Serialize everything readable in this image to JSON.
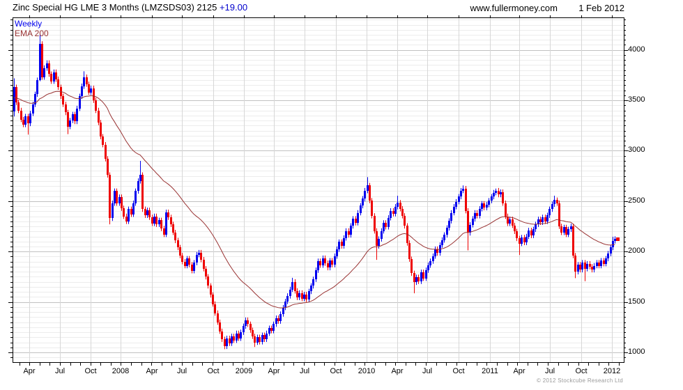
{
  "header": {
    "instrument": "Zinc Special HG LME 3 Months (LMZSDS03) 2125",
    "change": "+19.00",
    "website": "www.fullermoney.com",
    "date": "1 Feb 2012"
  },
  "legend": {
    "timeframe": "Weekly",
    "overlay": "EMA 200"
  },
  "footer": {
    "copyright": "© 2012 Stockcube Research Ltd"
  },
  "colors": {
    "up": "#0000ee",
    "down": "#ee0000",
    "ema": "#993333",
    "grid_minor": "#ececec",
    "grid_major": "#c1c1c1",
    "grid_vertical": "#d7d7d7",
    "frame": "#000000",
    "last_price_marker": "#ee0000",
    "change_text": "#0000cc",
    "copyright_text": "#9a9a9a"
  },
  "chart_data": {
    "type": "candlestick",
    "title": "Zinc Special HG LME 3 Months (LMZSDS03)",
    "timeframe": "Weekly",
    "overlay": "EMA 200",
    "last_price": 2125,
    "change": 19.0,
    "y_axis": {
      "side": "right",
      "min": 900,
      "max": 4330,
      "tick_labels": [
        4000,
        3500,
        3000,
        2500,
        2000,
        1500,
        1000
      ],
      "minor_step": 50,
      "major_step": 500,
      "grid": true
    },
    "x_axis": {
      "grid": "quarterly",
      "labels": [
        {
          "label": "Apr",
          "week": 6.7
        },
        {
          "label": "Jul",
          "week": 19.8
        },
        {
          "label": "Oct",
          "week": 32.9
        },
        {
          "label": "2008",
          "week": 45.8
        },
        {
          "label": "Apr",
          "week": 59.0
        },
        {
          "label": "Jul",
          "week": 72.0
        },
        {
          "label": "Oct",
          "week": 85.2
        },
        {
          "label": "2009",
          "week": 98.4
        },
        {
          "label": "Apr",
          "week": 111.3
        },
        {
          "label": "Jul",
          "week": 124.3
        },
        {
          "label": "Oct",
          "week": 137.6
        },
        {
          "label": "2010",
          "week": 150.9
        },
        {
          "label": "Apr",
          "week": 163.8
        },
        {
          "label": "Jul",
          "week": 176.8
        },
        {
          "label": "Oct",
          "week": 190.1
        },
        {
          "label": "2011",
          "week": 203.4
        },
        {
          "label": "Apr",
          "week": 216.2
        },
        {
          "label": "Jul",
          "week": 229.2
        },
        {
          "label": "Oct",
          "week": 242.5
        },
        {
          "label": "2012",
          "week": 255.8
        }
      ]
    },
    "first_open": 3390,
    "closes": [
      3630,
      3480,
      3400,
      3310,
      3260,
      3340,
      3270,
      3370,
      3460,
      3560,
      3700,
      4060,
      3730,
      3820,
      3870,
      3760,
      3690,
      3780,
      3710,
      3630,
      3540,
      3460,
      3380,
      3240,
      3300,
      3360,
      3290,
      3420,
      3540,
      3640,
      3730,
      3660,
      3580,
      3620,
      3500,
      3400,
      3280,
      3140,
      3060,
      2920,
      2760,
      2330,
      2480,
      2600,
      2480,
      2540,
      2430,
      2350,
      2300,
      2420,
      2370,
      2480,
      2600,
      2700,
      2760,
      2420,
      2360,
      2410,
      2340,
      2280,
      2350,
      2270,
      2310,
      2230,
      2170,
      2390,
      2340,
      2270,
      2190,
      2110,
      2040,
      1960,
      1900,
      1860,
      1930,
      1870,
      1810,
      1890,
      1970,
      1990,
      1920,
      1830,
      1750,
      1660,
      1570,
      1480,
      1390,
      1300,
      1210,
      1130,
      1060,
      1140,
      1090,
      1160,
      1120,
      1190,
      1140,
      1200,
      1260,
      1320,
      1280,
      1220,
      1160,
      1100,
      1150,
      1105,
      1170,
      1130,
      1190,
      1240,
      1215,
      1280,
      1340,
      1310,
      1380,
      1445,
      1505,
      1560,
      1625,
      1700,
      1610,
      1545,
      1590,
      1535,
      1575,
      1525,
      1605,
      1660,
      1725,
      1815,
      1905,
      1865,
      1935,
      1885,
      1840,
      1910,
      1870,
      1955,
      2025,
      2095,
      2055,
      2135,
      2205,
      2165,
      2255,
      2325,
      2285,
      2385,
      2455,
      2525,
      2605,
      2655,
      2505,
      2355,
      2205,
      2055,
      2125,
      2205,
      2285,
      2245,
      2335,
      2405,
      2375,
      2445,
      2485,
      2425,
      2355,
      2255,
      2085,
      1925,
      1785,
      1695,
      1745,
      1705,
      1795,
      1735,
      1815,
      1865,
      1905,
      1955,
      2025,
      1985,
      2065,
      2115,
      2165,
      2235,
      2305,
      2385,
      2445,
      2495,
      2545,
      2605,
      2625,
      2405,
      2185,
      2265,
      2325,
      2385,
      2355,
      2425,
      2475,
      2435,
      2465,
      2505,
      2545,
      2585,
      2605,
      2565,
      2590,
      2480,
      2350,
      2280,
      2320,
      2260,
      2200,
      2130,
      2080,
      2140,
      2090,
      2150,
      2210,
      2160,
      2220,
      2270,
      2320,
      2290,
      2340,
      2300,
      2360,
      2420,
      2470,
      2510,
      2480,
      2250,
      2190,
      2240,
      2170,
      2220,
      2250,
      1960,
      1800,
      1870,
      1820,
      1890,
      1830,
      1880,
      1850,
      1820,
      1860,
      1890,
      1860,
      1910,
      1880,
      1930,
      1980,
      2040,
      2106,
      2125
    ],
    "wick_default": 26,
    "wick_overrides": {
      "0": [
        3718,
        3340
      ],
      "6": [
        null,
        3160
      ],
      "11": [
        4168,
        3690
      ],
      "23": [
        null,
        3165
      ],
      "30": [
        3788,
        null
      ],
      "41": [
        null,
        2270
      ],
      "54": [
        2900,
        null
      ],
      "90": [
        null,
        1032
      ],
      "103": [
        null,
        1054
      ],
      "119": [
        1740,
        null
      ],
      "151": [
        2738,
        null
      ],
      "155": [
        null,
        1918
      ],
      "164": [
        2553,
        null
      ],
      "171": [
        null,
        1586
      ],
      "192": [
        2656,
        null
      ],
      "194": [
        null,
        2012
      ],
      "206": [
        2625,
        null
      ],
      "216": [
        null,
        1966
      ],
      "231": [
        2554,
        null
      ],
      "240": [
        null,
        1737
      ],
      "244": [
        null,
        1706
      ],
      "256": [
        2148,
        null
      ]
    },
    "ema_span": 40,
    "ema_seed": 3520
  }
}
